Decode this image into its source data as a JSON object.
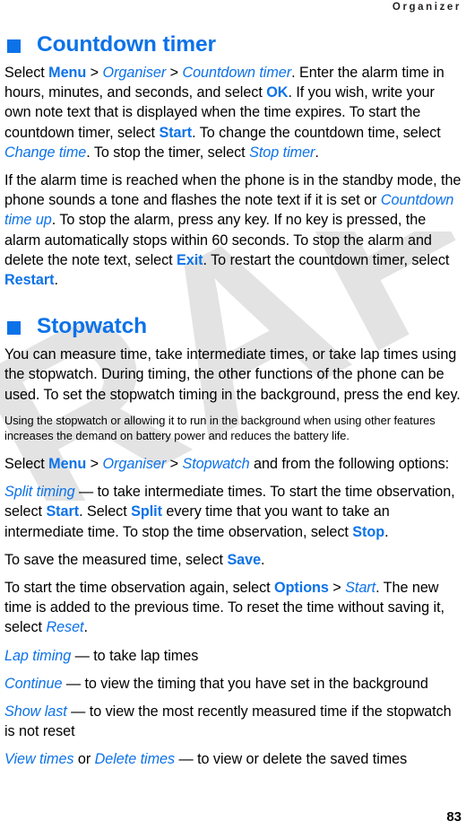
{
  "running_head": "Organizer",
  "folio": "83",
  "watermark": {
    "text": "DRAFT",
    "color": "#e3e3e3"
  },
  "colors": {
    "accent_blue": "#0c72e8",
    "body_text": "#000000",
    "running_head": "#231f20"
  },
  "sections": [
    {
      "id": "countdown-timer",
      "heading": "Countdown timer",
      "blocks": [
        {
          "type": "body",
          "id": "countdown-p1",
          "runs": [
            {
              "t": "plain",
              "text": "Select "
            },
            {
              "t": "cmd",
              "text": "Menu"
            },
            {
              "t": "plain",
              "text": " > "
            },
            {
              "t": "ref",
              "text": "Organiser"
            },
            {
              "t": "plain",
              "text": " > "
            },
            {
              "t": "ref",
              "text": "Countdown timer"
            },
            {
              "t": "plain",
              "text": ". Enter the alarm time in hours, minutes, and seconds, and select "
            },
            {
              "t": "cmd",
              "text": "OK"
            },
            {
              "t": "plain",
              "text": ". If you wish, write your own note text that is displayed when the time expires. To start the countdown timer, select "
            },
            {
              "t": "cmd",
              "text": "Start"
            },
            {
              "t": "plain",
              "text": ". To change the countdown time, select "
            },
            {
              "t": "ref",
              "text": "Change time"
            },
            {
              "t": "plain",
              "text": ". To stop the timer, select "
            },
            {
              "t": "ref",
              "text": "Stop timer"
            },
            {
              "t": "plain",
              "text": "."
            }
          ]
        },
        {
          "type": "body",
          "id": "countdown-p2",
          "runs": [
            {
              "t": "plain",
              "text": "If the alarm time is reached when the phone is in the standby mode, the phone sounds a tone and flashes the note text if it is set or "
            },
            {
              "t": "ref",
              "text": "Countdown time up"
            },
            {
              "t": "plain",
              "text": ". To stop the alarm, press any key. If no key is pressed, the alarm automatically stops within 60 seconds. To stop the alarm and delete the note text, select "
            },
            {
              "t": "cmd",
              "text": "Exit"
            },
            {
              "t": "plain",
              "text": ". To restart the countdown timer, select "
            },
            {
              "t": "cmd",
              "text": "Restart"
            },
            {
              "t": "plain",
              "text": "."
            }
          ]
        }
      ]
    },
    {
      "id": "stopwatch",
      "heading": "Stopwatch",
      "blocks": [
        {
          "type": "body",
          "id": "stopwatch-p1",
          "runs": [
            {
              "t": "plain",
              "text": "You can measure time, take intermediate times, or take lap times using the stopwatch. During timing, the other functions of the phone can be used. To set the stopwatch timing in the background, press the end key."
            }
          ]
        },
        {
          "type": "note",
          "id": "stopwatch-note",
          "runs": [
            {
              "t": "plain",
              "text": "Using the stopwatch or allowing it to run in the background when using other features increases the demand on battery power and reduces the battery life."
            }
          ]
        },
        {
          "type": "body",
          "id": "stopwatch-p2",
          "runs": [
            {
              "t": "plain",
              "text": "Select "
            },
            {
              "t": "cmd",
              "text": "Menu"
            },
            {
              "t": "plain",
              "text": " > "
            },
            {
              "t": "ref",
              "text": "Organiser"
            },
            {
              "t": "plain",
              "text": " > "
            },
            {
              "t": "ref",
              "text": "Stopwatch"
            },
            {
              "t": "plain",
              "text": " and from the following options:"
            }
          ]
        },
        {
          "type": "option",
          "id": "option-split-timing",
          "runs": [
            {
              "t": "ref",
              "text": "Split timing"
            },
            {
              "t": "plain",
              "text": " — to take intermediate times. To start the time observation, select "
            },
            {
              "t": "cmd",
              "text": "Start"
            },
            {
              "t": "plain",
              "text": ". Select "
            },
            {
              "t": "cmd",
              "text": "Split"
            },
            {
              "t": "plain",
              "text": " every time that you want to take an intermediate time. To stop the time observation, select "
            },
            {
              "t": "cmd",
              "text": "Stop"
            },
            {
              "t": "plain",
              "text": "."
            }
          ]
        },
        {
          "type": "body",
          "id": "stopwatch-p3",
          "runs": [
            {
              "t": "plain",
              "text": "To save the measured time, select "
            },
            {
              "t": "cmd",
              "text": "Save"
            },
            {
              "t": "plain",
              "text": "."
            }
          ]
        },
        {
          "type": "body",
          "id": "stopwatch-p4",
          "runs": [
            {
              "t": "plain",
              "text": "To start the time observation again, select "
            },
            {
              "t": "cmd",
              "text": "Options"
            },
            {
              "t": "plain",
              "text": " > "
            },
            {
              "t": "ref",
              "text": "Start"
            },
            {
              "t": "plain",
              "text": ". The new time is added to the previous time. To reset the time without saving it, select "
            },
            {
              "t": "ref",
              "text": "Reset"
            },
            {
              "t": "plain",
              "text": "."
            }
          ]
        },
        {
          "type": "option",
          "id": "option-lap-timing",
          "runs": [
            {
              "t": "ref",
              "text": "Lap timing"
            },
            {
              "t": "plain",
              "text": " — to take lap times"
            }
          ]
        },
        {
          "type": "option",
          "id": "option-continue",
          "runs": [
            {
              "t": "ref",
              "text": "Continue"
            },
            {
              "t": "plain",
              "text": " — to view the timing that you have set in the background"
            }
          ]
        },
        {
          "type": "option",
          "id": "option-show-last",
          "runs": [
            {
              "t": "ref",
              "text": "Show last"
            },
            {
              "t": "plain",
              "text": " — to view the most recently measured time if the stopwatch is not reset"
            }
          ]
        },
        {
          "type": "option",
          "id": "option-view-delete-times",
          "runs": [
            {
              "t": "ref",
              "text": "View times"
            },
            {
              "t": "plain",
              "text": " or "
            },
            {
              "t": "ref",
              "text": "Delete times"
            },
            {
              "t": "plain",
              "text": " — to view or delete the saved times"
            }
          ]
        }
      ]
    }
  ]
}
